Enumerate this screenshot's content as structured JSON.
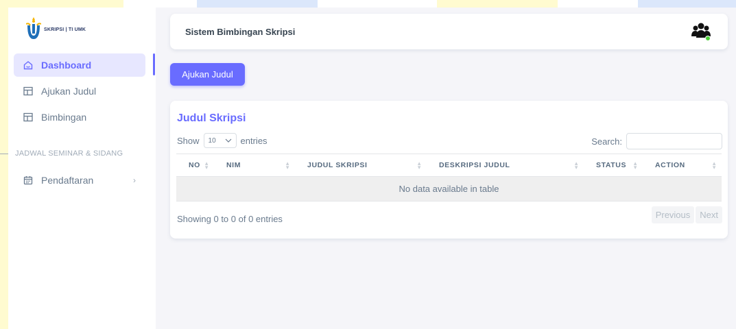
{
  "brand": {
    "text": "SKRIPSI | TI UMK"
  },
  "sidebar": {
    "items": [
      {
        "label": "Dashboard",
        "icon": "home-icon",
        "active": true
      },
      {
        "label": "Ajukan Judul",
        "icon": "layout-icon",
        "active": false
      },
      {
        "label": "Bimbingan",
        "icon": "layout-icon",
        "active": false
      }
    ],
    "section_header": "JADWAL SEMINAR & SIDANG",
    "submenu": {
      "label": "Pendaftaran",
      "icon": "calendar-icon"
    }
  },
  "navbar": {
    "title": "Sistem Bimbingan Skripsi",
    "user_icon": "users-icon"
  },
  "actions": {
    "ajukan_label": "Ajukan Judul"
  },
  "table_card": {
    "title": "Judul Skripsi",
    "show_label": "Show",
    "length_value": "10",
    "entries_label": "entries",
    "search_label": "Search:",
    "columns": [
      "NO",
      "NIM",
      "JUDUL SKRIPSI",
      "DESKRIPSI JUDUL",
      "STATUS",
      "ACTION"
    ],
    "empty_message": "No data available in table",
    "info": "Showing 0 to 0 of 0 entries",
    "prev_label": "Previous",
    "next_label": "Next"
  },
  "colors": {
    "accent": "#696cff",
    "active_bg": "#e7e7ff",
    "background": "#f5f5f9"
  }
}
